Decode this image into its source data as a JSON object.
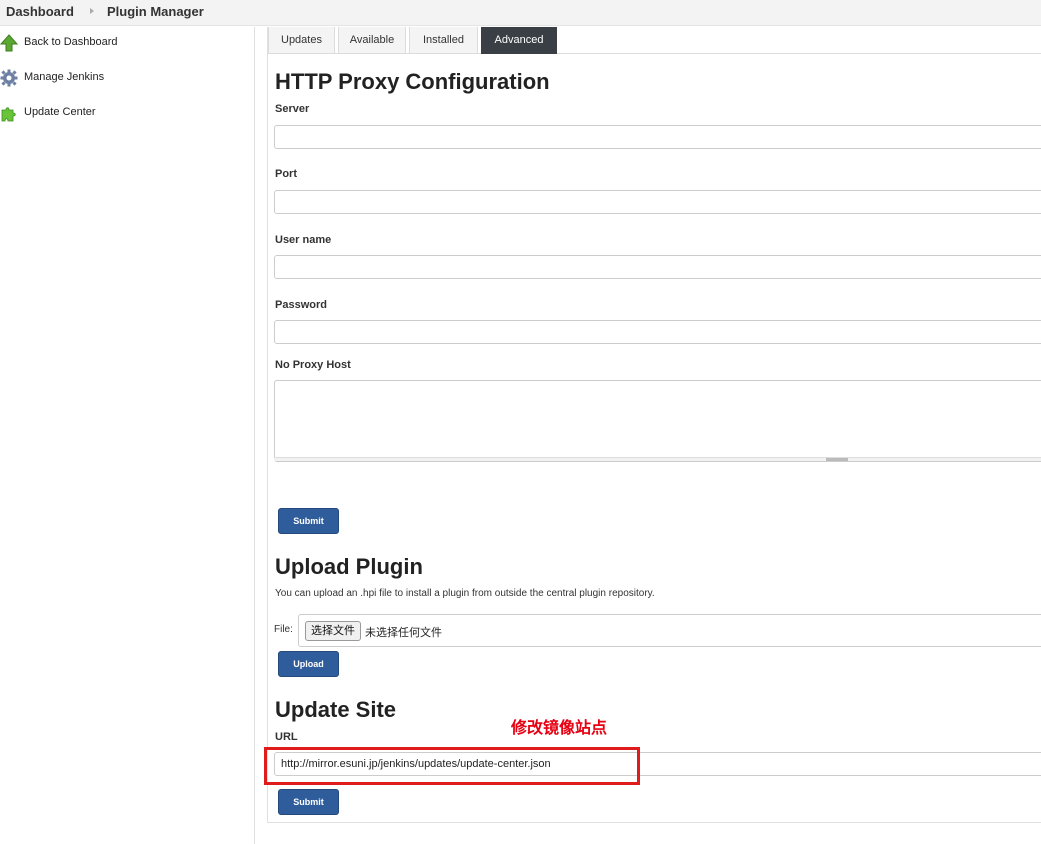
{
  "breadcrumb": {
    "home": "Dashboard",
    "current": "Plugin Manager"
  },
  "sidebar": {
    "items": [
      {
        "label": "Back to Dashboard",
        "icon": "up-arrow-icon"
      },
      {
        "label": "Manage Jenkins",
        "icon": "gear-icon"
      },
      {
        "label": "Update Center",
        "icon": "puzzle-icon"
      }
    ]
  },
  "tabs": [
    "Updates",
    "Available",
    "Installed",
    "Advanced"
  ],
  "active_tab": "Advanced",
  "proxy": {
    "title": "HTTP Proxy Configuration",
    "server_label": "Server",
    "server_value": "",
    "port_label": "Port",
    "port_value": "",
    "username_label": "User name",
    "username_value": "",
    "password_label": "Password",
    "password_value": "",
    "noproxy_label": "No Proxy Host",
    "submit_label": "Submit"
  },
  "upload": {
    "title": "Upload Plugin",
    "description": "You can upload an .hpi file to install a plugin from outside the central plugin repository.",
    "file_label": "File:",
    "choose_label": "选择文件",
    "no_file_text": "未选择任何文件",
    "upload_label": "Upload"
  },
  "update_site": {
    "title": "Update Site",
    "url_label": "URL",
    "url_value": "http://mirror.esuni.jp/jenkins/updates/update-center.json",
    "submit_label": "Submit"
  },
  "annotation": {
    "text": "修改镜像站点",
    "color": "#e60012"
  },
  "colors": {
    "button": "#2f5d9b",
    "active_tab": "#3a3f45",
    "highlight": "#e01b1b"
  }
}
